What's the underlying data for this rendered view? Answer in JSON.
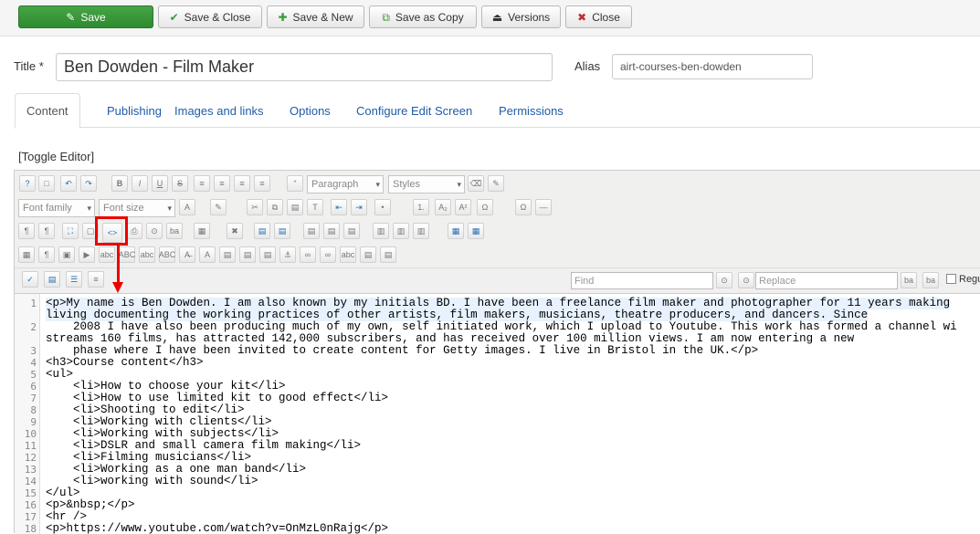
{
  "toolbar": {
    "save": "Save",
    "save_close": "Save & Close",
    "save_new": "Save & New",
    "save_copy": "Save as Copy",
    "versions": "Versions",
    "close": "Close"
  },
  "form": {
    "title_label": "Title *",
    "title_value": "Ben Dowden - Film Maker",
    "alias_label": "Alias",
    "alias_value": "airt-courses-ben-dowden"
  },
  "tabs": [
    "Content",
    "Publishing",
    "Images and links",
    "Options",
    "Configure Edit Screen",
    "Permissions"
  ],
  "toggle_editor": "[Toggle Editor]",
  "editor_toolbar": {
    "paragraph": "Paragraph",
    "styles": "Styles",
    "font_family": "Font family",
    "font_size": "Font size"
  },
  "find_replace": {
    "find_placeholder": "Find",
    "replace_placeholder": "Replace",
    "regex_label": "Regu"
  },
  "code_lines": [
    {
      "n": "1",
      "t": "<p>My name is Ben Dowden. I am also known by my initials BD. I have been a freelance film maker and photographer for 11 years making"
    },
    {
      "n": "",
      "t": "living documenting the working practices of other artists, film makers, musicians, theatre producers, and dancers. Since"
    },
    {
      "n": "2",
      "t": "    2008 I have also been producing much of my own, self initiated work, which I upload to Youtube. This work has formed a channel wi"
    },
    {
      "n": "",
      "t": "streams 160 films, has attracted 142,000 subscribers, and has received over 100 million views. I am now entering a new"
    },
    {
      "n": "3",
      "t": "    phase where I have been invited to create content for Getty images. I live in Bristol in the UK.</p>"
    },
    {
      "n": "4",
      "t": "<h3>Course content</h3>"
    },
    {
      "n": "5",
      "t": "<ul>"
    },
    {
      "n": "6",
      "t": "    <li>How to choose your kit</li>"
    },
    {
      "n": "7",
      "t": "    <li>How to use limited kit to good effect</li>"
    },
    {
      "n": "8",
      "t": "    <li>Shooting to edit</li>"
    },
    {
      "n": "9",
      "t": "    <li>Working with clients</li>"
    },
    {
      "n": "10",
      "t": "    <li>Working with subjects</li>"
    },
    {
      "n": "11",
      "t": "    <li>DSLR and small camera film making</li>"
    },
    {
      "n": "12",
      "t": "    <li>Filming musicians</li>"
    },
    {
      "n": "13",
      "t": "    <li>Working as a one man band</li>"
    },
    {
      "n": "14",
      "t": "    <li>working with sound</li>"
    },
    {
      "n": "15",
      "t": "</ul>"
    },
    {
      "n": "16",
      "t": "<p>&nbsp;</p>"
    },
    {
      "n": "17",
      "t": "<hr />"
    },
    {
      "n": "18",
      "t": "<p>https://www.youtube.com/watch?v=OnMzL0nRajg</p>"
    }
  ]
}
